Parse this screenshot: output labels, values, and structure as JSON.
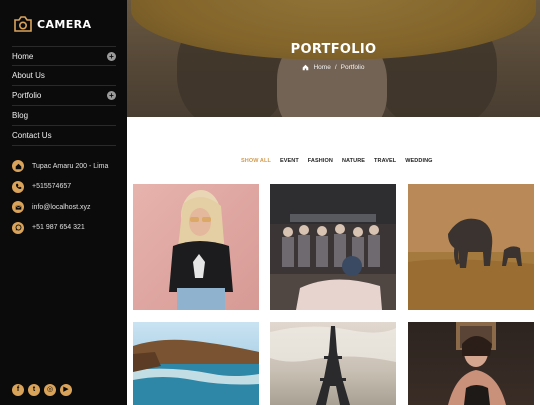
{
  "brand": {
    "name": "CAMERA",
    "icon": "camera-icon"
  },
  "nav": [
    {
      "label": "Home",
      "has_submenu": true
    },
    {
      "label": "About Us",
      "has_submenu": false
    },
    {
      "label": "Portfolio",
      "has_submenu": true
    },
    {
      "label": "Blog",
      "has_submenu": false
    },
    {
      "label": "Contact Us",
      "has_submenu": false
    }
  ],
  "contacts": [
    {
      "icon": "home-icon",
      "text": "Tupac Amaru 200 - Lima"
    },
    {
      "icon": "phone-icon",
      "text": "+515574657"
    },
    {
      "icon": "email-icon",
      "text": "info@localhost.xyz"
    },
    {
      "icon": "whatsapp-icon",
      "text": "+51 987 654 321"
    }
  ],
  "socials": [
    {
      "icon": "facebook-icon",
      "glyph": "f"
    },
    {
      "icon": "twitter-icon",
      "glyph": "t"
    },
    {
      "icon": "instagram-icon",
      "glyph": "◎"
    },
    {
      "icon": "youtube-icon",
      "glyph": "▶"
    }
  ],
  "hero": {
    "title": "PORTFOLIO",
    "breadcrumb": {
      "home": "Home",
      "separator": "/",
      "current": "Portfolio"
    }
  },
  "filters": [
    "SHOW ALL",
    "EVENT",
    "FASHION",
    "NATURE",
    "TRAVEL",
    "WEDDING"
  ],
  "active_filter": "SHOW ALL",
  "gallery": [
    {
      "subject": "woman-pink-wall"
    },
    {
      "subject": "concert-crowd"
    },
    {
      "subject": "elephant-savanna"
    },
    {
      "subject": "coast-cliffs"
    },
    {
      "subject": "eiffel-tower"
    },
    {
      "subject": "woman-portrait"
    }
  ],
  "colors": {
    "accent": "#d9a35a",
    "sidebar": "#0b0b0b"
  }
}
